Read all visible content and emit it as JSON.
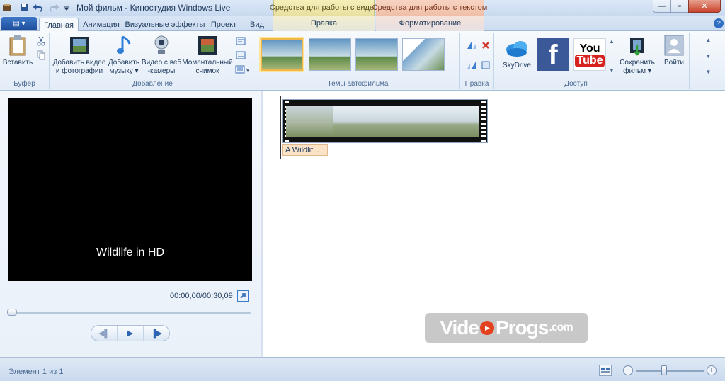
{
  "titlebar": {
    "title": "Мой фильм - Киностудия Windows Live",
    "contextual_video": "Средства для работы с видео",
    "contextual_text": "Средства для работы с текстом",
    "minimize": "—",
    "maximize": "▫",
    "close": "✕"
  },
  "tabs": {
    "app_menu": "▤ ▾",
    "items": [
      "Главная",
      "Анимация",
      "Визуальные эффекты",
      "Проект",
      "Вид"
    ],
    "contextual_video_tab": "Правка",
    "contextual_text_tab": "Форматирование",
    "help": "?"
  },
  "ribbon": {
    "clipboard": {
      "paste": "Вставить",
      "group": "Буфер"
    },
    "add": {
      "add_video_line1": "Добавить видео",
      "add_video_line2": "и фотографии",
      "add_music_line1": "Добавить",
      "add_music_line2": "музыку ▾",
      "webcam_line1": "Видео с веб",
      "webcam_line2": "-камеры",
      "snapshot_line1": "Моментальный",
      "snapshot_line2": "снимок",
      "group": "Добавление"
    },
    "themes": {
      "group": "Темы автофильма"
    },
    "edit": {
      "group": "Правка"
    },
    "share": {
      "skydrive": "SkyDrive",
      "youtube_top": "You",
      "youtube_bottom": "Tube",
      "facebook": "f",
      "save_line1": "Сохранить",
      "save_line2": "фильм ▾",
      "group": "Доступ"
    },
    "signin": {
      "label": "Войти"
    }
  },
  "preview": {
    "caption": "Wildlife in HD",
    "timecode": "00:00,00/00:30,09",
    "seek_position": 0.0,
    "prev_frame": "◀▌",
    "play": "▶",
    "next_frame": "▐▶"
  },
  "storyboard": {
    "clip_caption": "A Wildlif..."
  },
  "watermark": {
    "part1": "Vide",
    "part2": "Progs",
    "part3": ".com"
  },
  "statusbar": {
    "status": "Элемент 1 из 1",
    "zoom_out": "−",
    "zoom_in": "+",
    "zoom_level": 0.42
  },
  "colors": {
    "accent": "#2b5797",
    "ctx_video": "#e8e0a0",
    "ctx_text": "#efbfa8",
    "selection": "#f2b74a"
  }
}
